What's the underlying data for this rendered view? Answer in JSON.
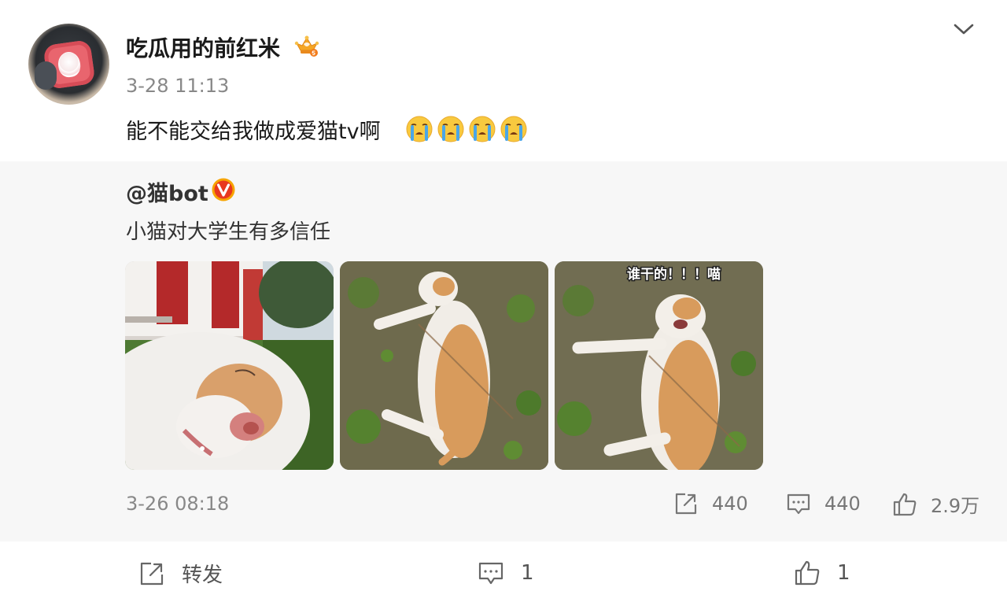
{
  "post": {
    "username": "吃瓜用的前红米",
    "time": "3-28 11:13",
    "text": "能不能交给我做成爱猫tv啊",
    "emojis": [
      "cry-emoji",
      "cry-emoji",
      "cry-emoji",
      "cry-emoji"
    ],
    "badge_icon": "crown-icon",
    "menu_icon": "chevron-down-icon"
  },
  "repost": {
    "author": "@猫bot",
    "verified_icon": "verified-icon",
    "text": "小猫对大学生有多信任",
    "photo_caption": "谁干的！！！喵",
    "time": "3-26 08:18",
    "shares": "440",
    "comments": "440",
    "likes": "2.9万"
  },
  "actions": {
    "forward_label": "转发",
    "comment_count": "1",
    "like_count": "1"
  },
  "colors": {
    "repost_background": "#f7f7f7",
    "verified": "#f7a400",
    "muted_text": "#888888"
  }
}
